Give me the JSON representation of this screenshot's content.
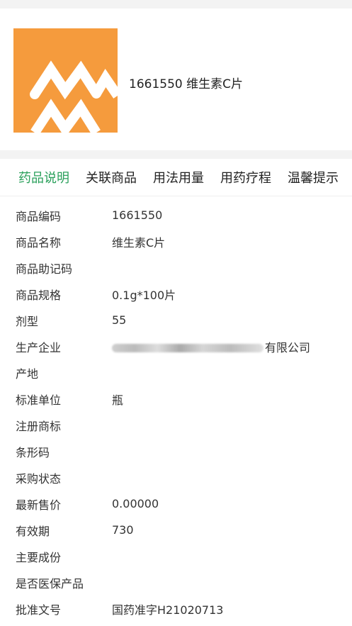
{
  "product": {
    "title": "1661550 维生素C片"
  },
  "tabs": [
    "药品说明",
    "关联商品",
    "用法用量",
    "用药疗程",
    "温馨提示"
  ],
  "details": [
    {
      "label": "商品编码",
      "value": "1661550"
    },
    {
      "label": "商品名称",
      "value": "维生素C片"
    },
    {
      "label": "商品助记码",
      "value": ""
    },
    {
      "label": "商品规格",
      "value": "0.1g*100片"
    },
    {
      "label": "剂型",
      "value": "55"
    },
    {
      "label": "生产企业",
      "value": "有限公司"
    },
    {
      "label": "产地",
      "value": ""
    },
    {
      "label": "标准单位",
      "value": "瓶"
    },
    {
      "label": "注册商标",
      "value": ""
    },
    {
      "label": "条形码",
      "value": ""
    },
    {
      "label": "采购状态",
      "value": ""
    },
    {
      "label": "最新售价",
      "value": "0.00000"
    },
    {
      "label": "有效期",
      "value": "730"
    },
    {
      "label": "主要成份",
      "value": ""
    },
    {
      "label": "是否医保产品",
      "value": ""
    },
    {
      "label": "批准文号",
      "value": "国药准字H21020713"
    }
  ],
  "colors": {
    "accent": "#2aa05b",
    "logo_bg": "#f59b3d"
  }
}
